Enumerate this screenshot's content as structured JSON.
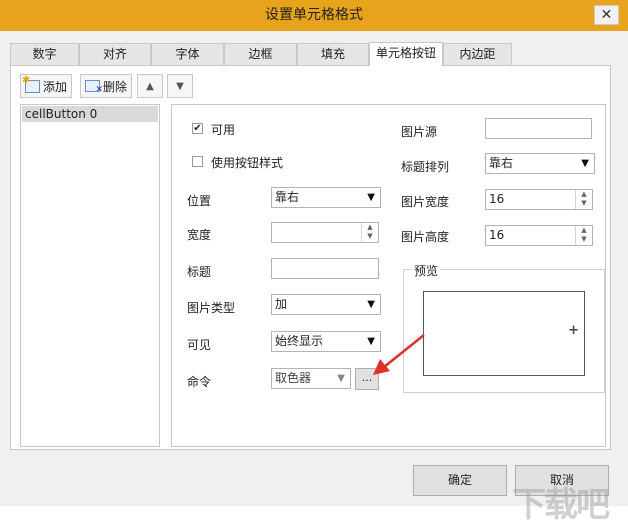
{
  "dialog": {
    "title": "设置单元格格式",
    "close_glyph": "✕"
  },
  "tabs": [
    "数字",
    "对齐",
    "字体",
    "边框",
    "填充",
    "单元格按钮",
    "内边距"
  ],
  "toolbar": {
    "add_label": "添加",
    "delete_label": "删除"
  },
  "list": {
    "items": [
      "cellButton 0"
    ]
  },
  "props": {
    "enabled_label": "可用",
    "enabled_checked": true,
    "use_button_style_label": "使用按钮样式",
    "use_button_style_checked": false,
    "position_label": "位置",
    "position_value": "靠右",
    "width_label": "宽度",
    "width_value": "",
    "caption_label": "标题",
    "caption_value": "",
    "image_type_label": "图片类型",
    "image_type_value": "加",
    "visible_label": "可见",
    "visible_value": "始终显示",
    "command_label": "命令",
    "command_value": "取色器",
    "ellipsis": "...",
    "image_source_label": "图片源",
    "image_source_value": "",
    "caption_align_label": "标题排列",
    "caption_align_value": "靠右",
    "image_width_label": "图片宽度",
    "image_width_value": "16",
    "image_height_label": "图片高度",
    "image_height_value": "16",
    "preview_label": "预览",
    "preview_glyph": "+"
  },
  "footer": {
    "ok_label": "确定",
    "cancel_label": "取消"
  },
  "watermark": "下载吧",
  "colors": {
    "title_bar": "#e6a31b",
    "client_bg": "#f0f0f0",
    "arrow": "#e0302a"
  }
}
